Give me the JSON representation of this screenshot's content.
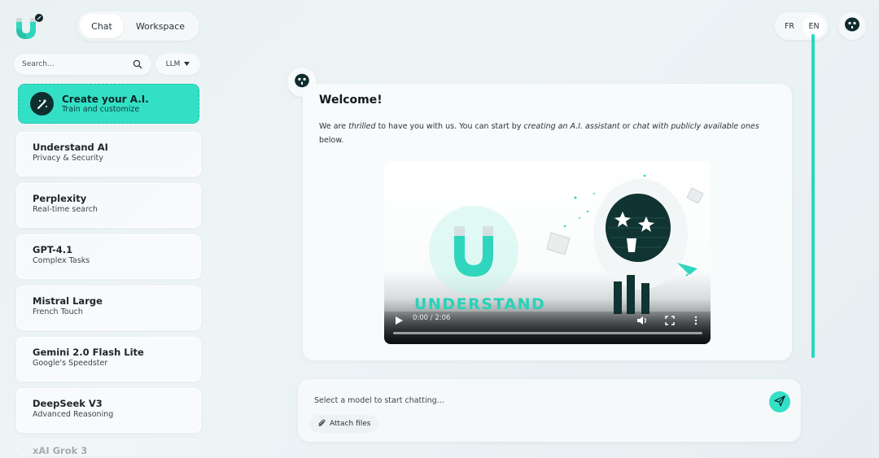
{
  "app": {
    "brand_icon": "horseshoe-magnet-logo",
    "accent_color": "#33e0c6"
  },
  "header": {
    "tabs": [
      {
        "label": "Chat",
        "active": true
      },
      {
        "label": "Workspace",
        "active": false
      }
    ],
    "languages": [
      {
        "label": "FR",
        "active": false
      },
      {
        "label": "EN",
        "active": true
      }
    ],
    "user_avatar_icon": "robot-face-icon"
  },
  "sidebar": {
    "search": {
      "placeholder": "Search...",
      "value": ""
    },
    "llm_filter": {
      "label": "LLM"
    },
    "create": {
      "title": "Create your A.I.",
      "subtitle": "Train and customize",
      "icon": "magic-wand-icon"
    },
    "models": [
      {
        "name": "Understand AI",
        "desc": "Privacy & Security"
      },
      {
        "name": "Perplexity",
        "desc": "Real-time search"
      },
      {
        "name": "GPT-4.1",
        "desc": "Complex Tasks"
      },
      {
        "name": "Mistral Large",
        "desc": "French Touch"
      },
      {
        "name": "Gemini 2.0 Flash Lite",
        "desc": "Google's Speedster"
      },
      {
        "name": "DeepSeek V3",
        "desc": "Advanced Reasoning"
      },
      {
        "name": "xAI Grok 3",
        "desc": ""
      }
    ]
  },
  "chat": {
    "welcome_title": "Welcome!",
    "welcome_text_1": "We are ",
    "welcome_text_em1": "thrilled",
    "welcome_text_2": " to have you with us. You can start by ",
    "welcome_text_em2": "creating an A.I. assistant",
    "welcome_text_3": " or ",
    "welcome_text_em3": "chat with publicly available ones",
    "welcome_text_4": " below.",
    "video": {
      "wordmark": "UNDERSTAND",
      "time": "0:00 / 2:06",
      "progress": 0
    }
  },
  "composer": {
    "placeholder": "Select a model to start chatting...",
    "attach_label": "Attach files"
  }
}
